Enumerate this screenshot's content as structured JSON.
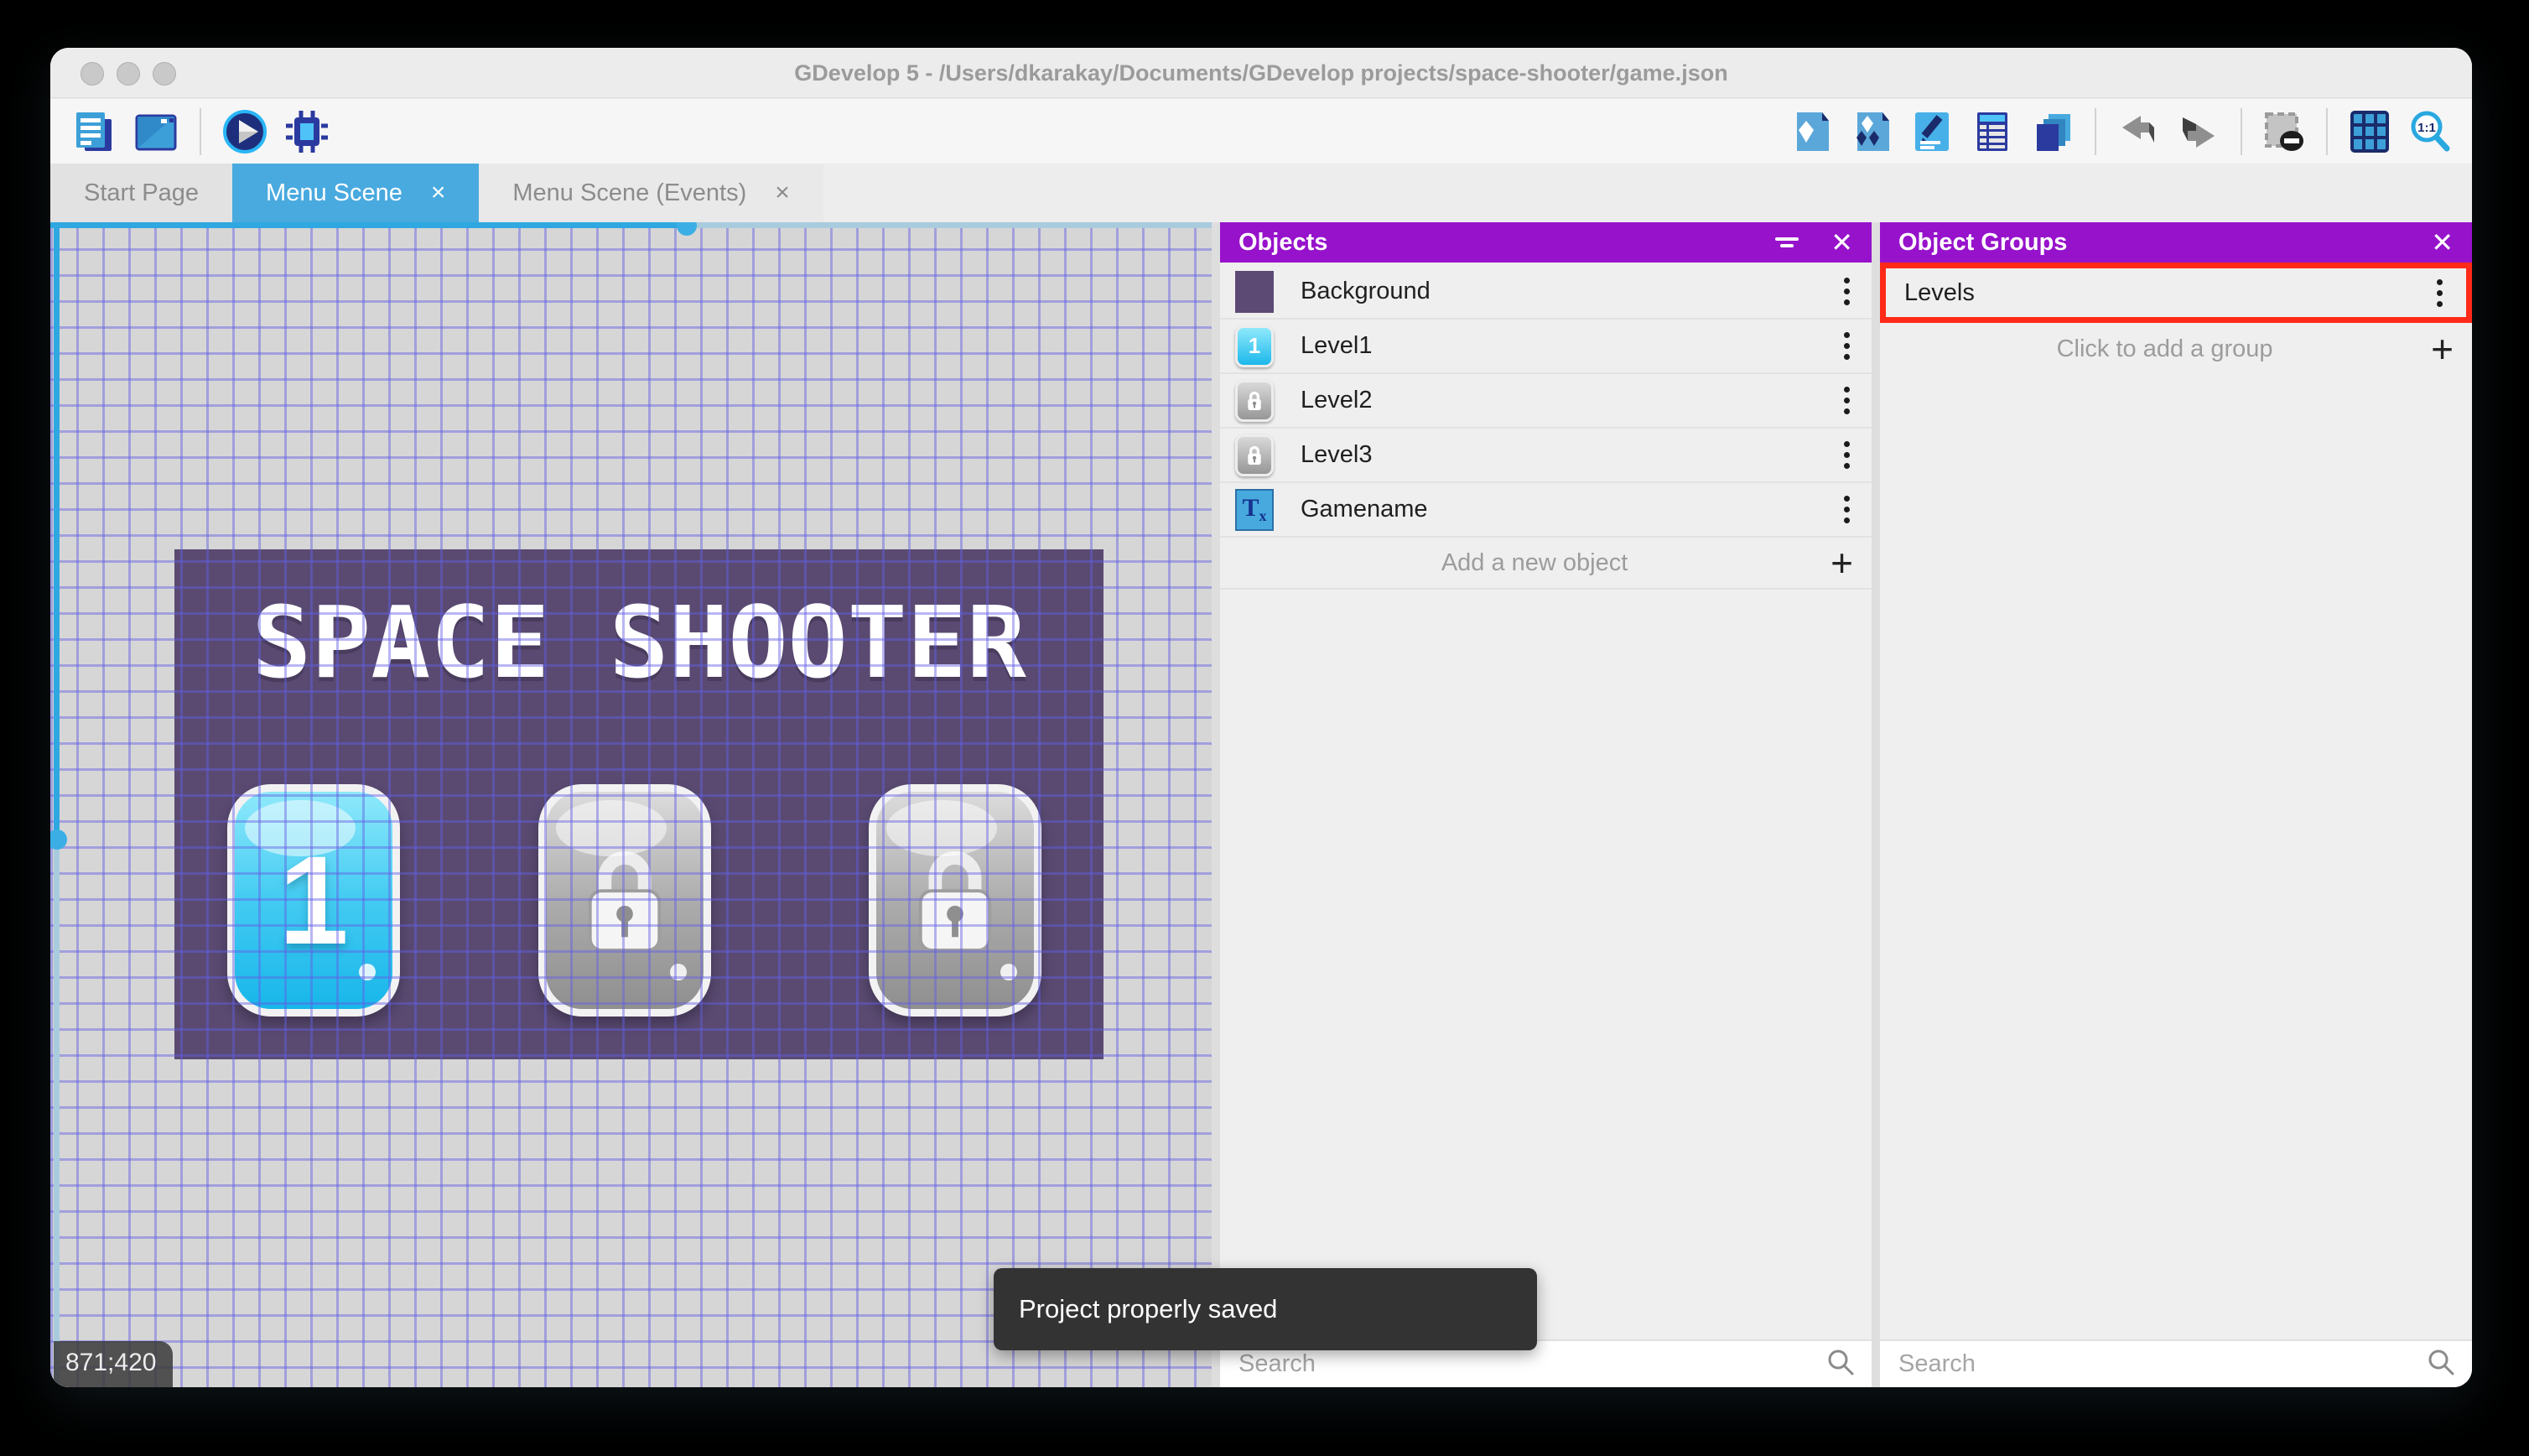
{
  "window": {
    "title": "GDevelop 5 - /Users/dkarakay/Documents/GDevelop projects/space-shooter/game.json"
  },
  "toolbar": {
    "left_icons": [
      {
        "name": "project-manager-icon"
      },
      {
        "name": "open-scene-icon"
      },
      {
        "name": "play-icon"
      },
      {
        "name": "debug-icon"
      }
    ],
    "right_icons": [
      {
        "name": "objects-editor-icon"
      },
      {
        "name": "object-groups-editor-icon"
      },
      {
        "name": "properties-icon"
      },
      {
        "name": "instances-list-icon"
      },
      {
        "name": "layers-icon"
      },
      {
        "name": "undo-icon"
      },
      {
        "name": "redo-icon"
      },
      {
        "name": "window-mask-icon"
      },
      {
        "name": "grid-icon"
      },
      {
        "name": "zoom-original-icon",
        "label": "1:1"
      }
    ]
  },
  "tabs": [
    {
      "label": "Start Page",
      "active": false,
      "closable": false
    },
    {
      "label": "Menu Scene",
      "active": true,
      "closable": true,
      "close_glyph": "×"
    },
    {
      "label": "Menu Scene (Events)",
      "active": false,
      "closable": true,
      "close_glyph": "×"
    }
  ],
  "scene": {
    "game_title": "SPACE SHOOTER",
    "level_buttons": [
      {
        "label": "1",
        "state": "unlocked"
      },
      {
        "label": "",
        "state": "locked"
      },
      {
        "label": "",
        "state": "locked"
      }
    ],
    "cursor_coordinates": "871;420"
  },
  "objects_panel": {
    "title": "Objects",
    "items": [
      {
        "name": "Background",
        "thumb": "background"
      },
      {
        "name": "Level1",
        "thumb": "level-unlocked",
        "thumb_label": "1"
      },
      {
        "name": "Level2",
        "thumb": "level-locked"
      },
      {
        "name": "Level3",
        "thumb": "level-locked"
      },
      {
        "name": "Gamename",
        "thumb": "text",
        "thumb_label": "T",
        "thumb_label_sub": "x"
      }
    ],
    "add_label": "Add a new object",
    "search_placeholder": "Search"
  },
  "groups_panel": {
    "title": "Object Groups",
    "items": [
      {
        "name": "Levels"
      }
    ],
    "add_label": "Click to add a group",
    "search_placeholder": "Search"
  },
  "toast": {
    "message": "Project properly saved"
  },
  "colors": {
    "accent_blue": "#49AADF",
    "header_purple": "#9712CB",
    "annotation_red": "#FF2A18",
    "toast_bg": "#333333",
    "scene_bg_purple": "#5A4A72"
  }
}
